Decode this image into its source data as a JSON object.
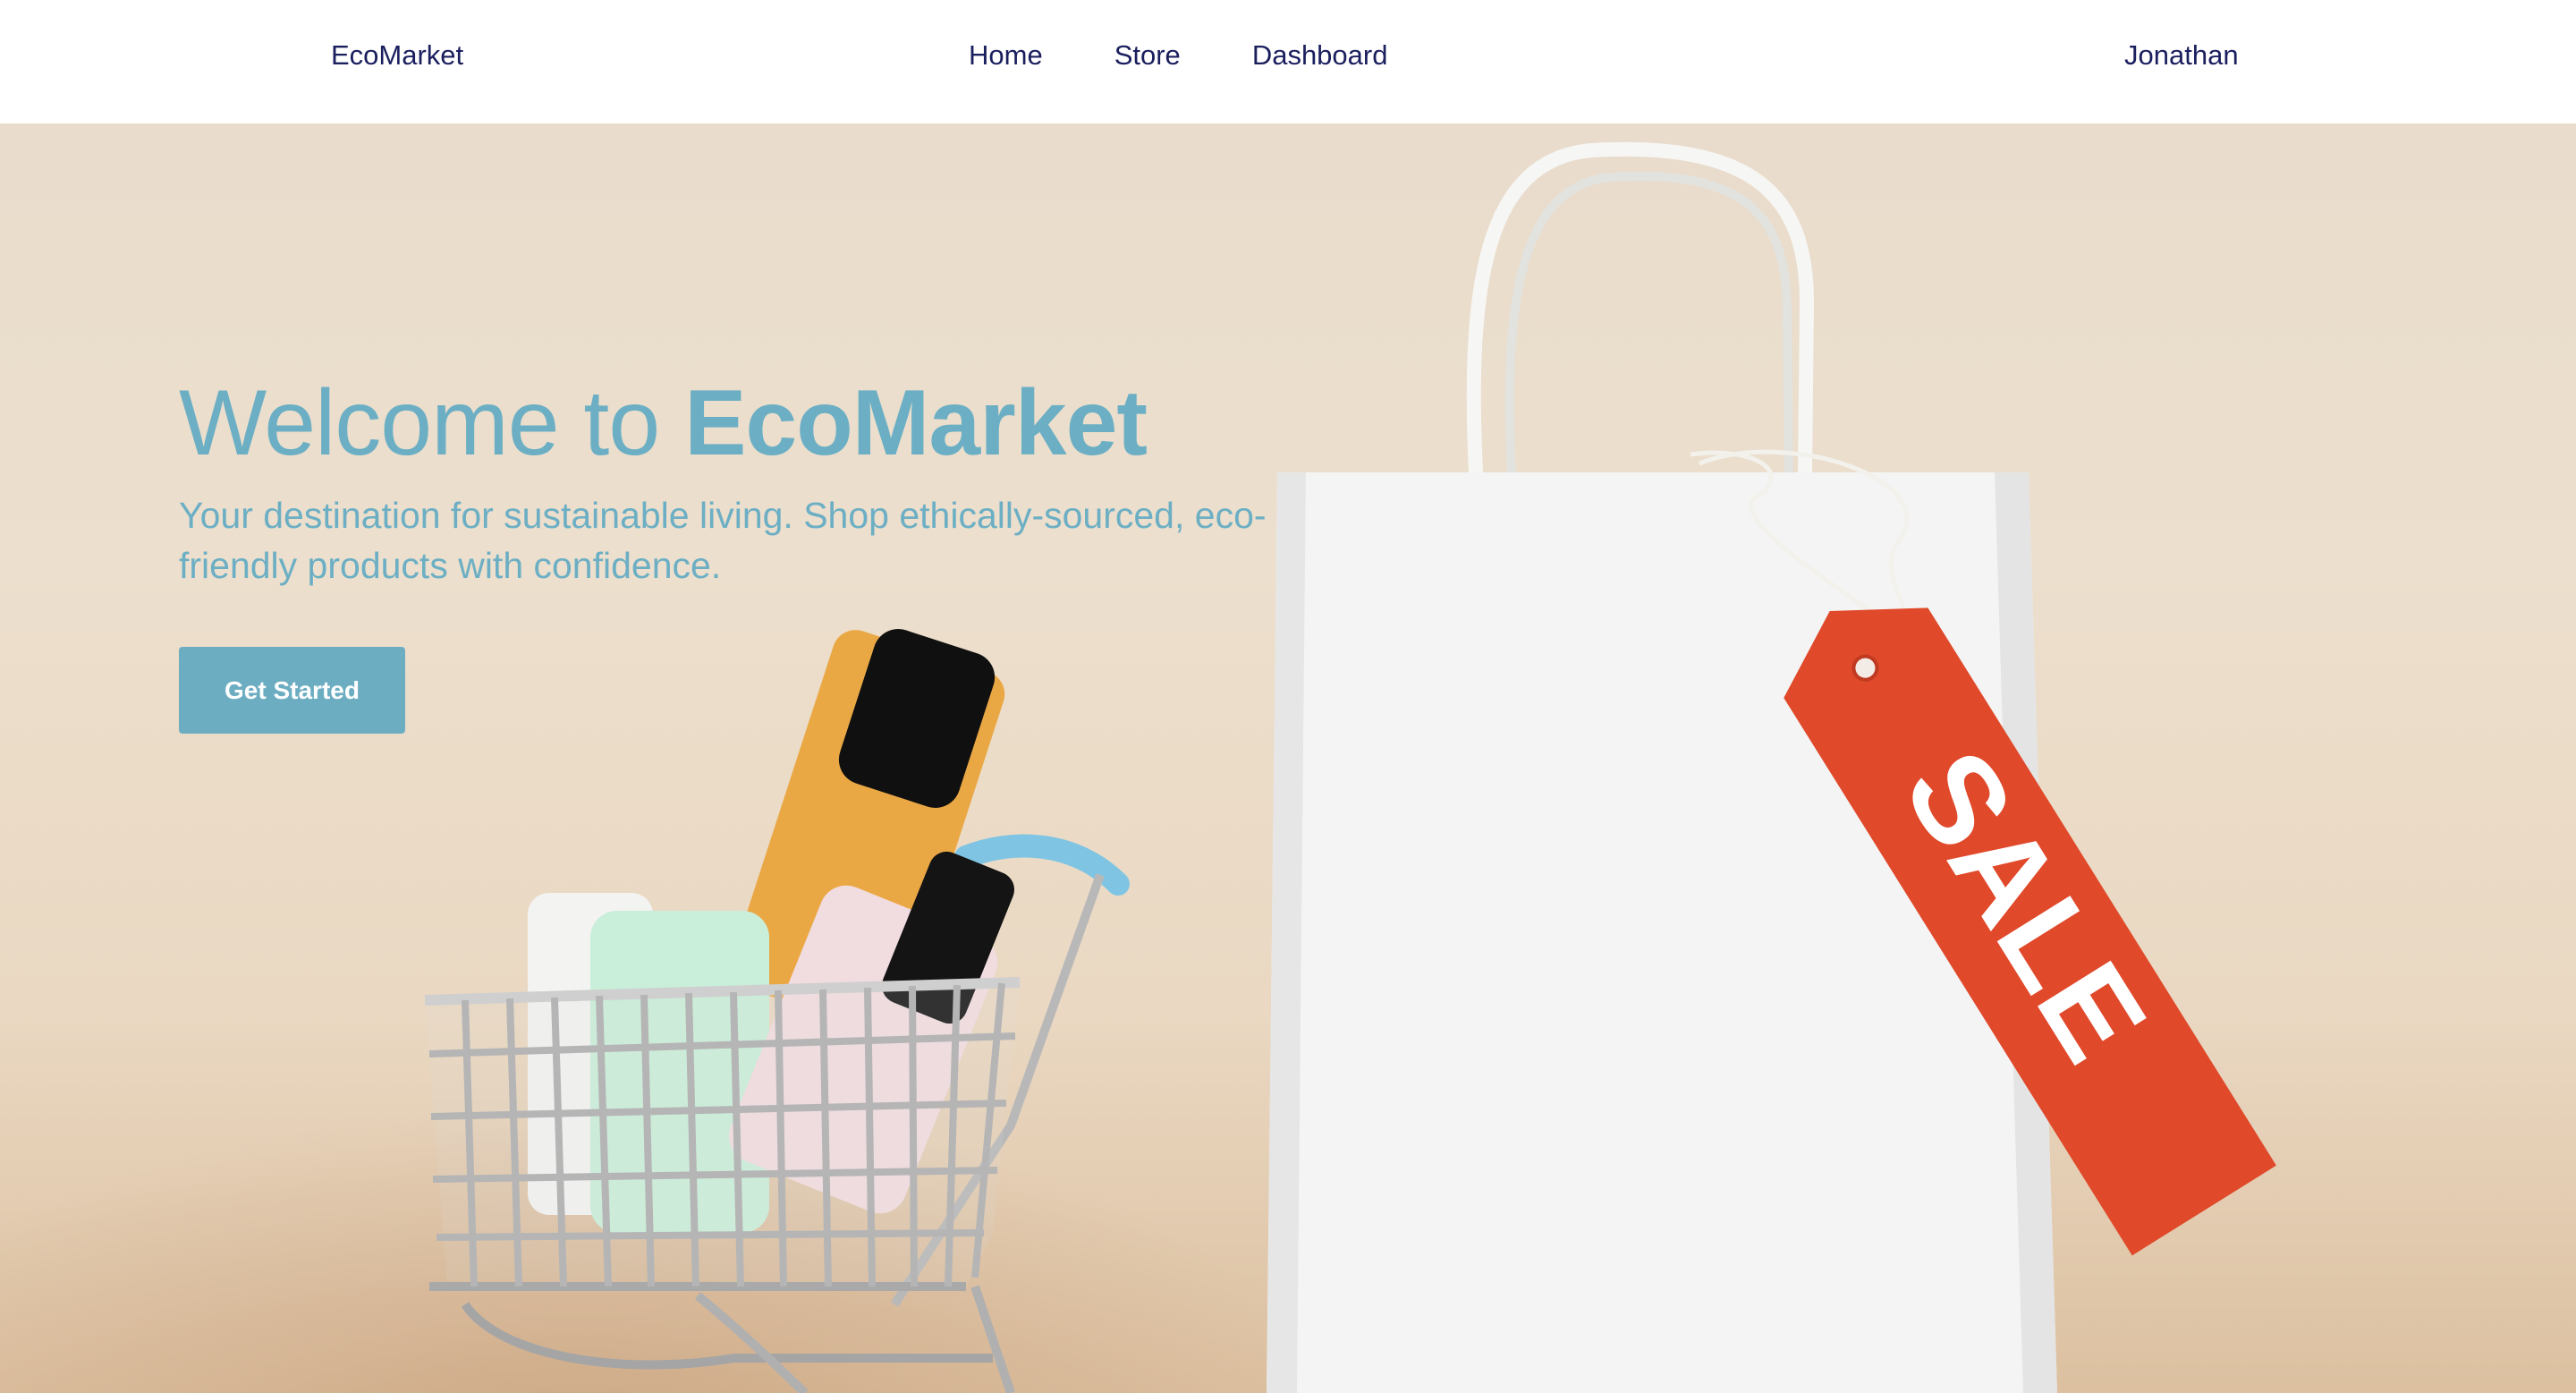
{
  "navbar": {
    "brand": "EcoMarket",
    "links": [
      {
        "label": "Home"
      },
      {
        "label": "Store"
      },
      {
        "label": "Dashboard"
      }
    ],
    "user": "Jonathan"
  },
  "hero": {
    "title_prefix": "Welcome to ",
    "title_brand": "EcoMarket",
    "subtitle": "Your destination for sustainable living. Shop ethically-sourced, eco-friendly products with confidence.",
    "cta_label": "Get Started",
    "tag_text": "SALE"
  },
  "colors": {
    "accent": "#6cadc1",
    "nav_text": "#1b1f5e",
    "hero_bg": "#ecdfcd",
    "sale_tag": "#e0492a"
  }
}
